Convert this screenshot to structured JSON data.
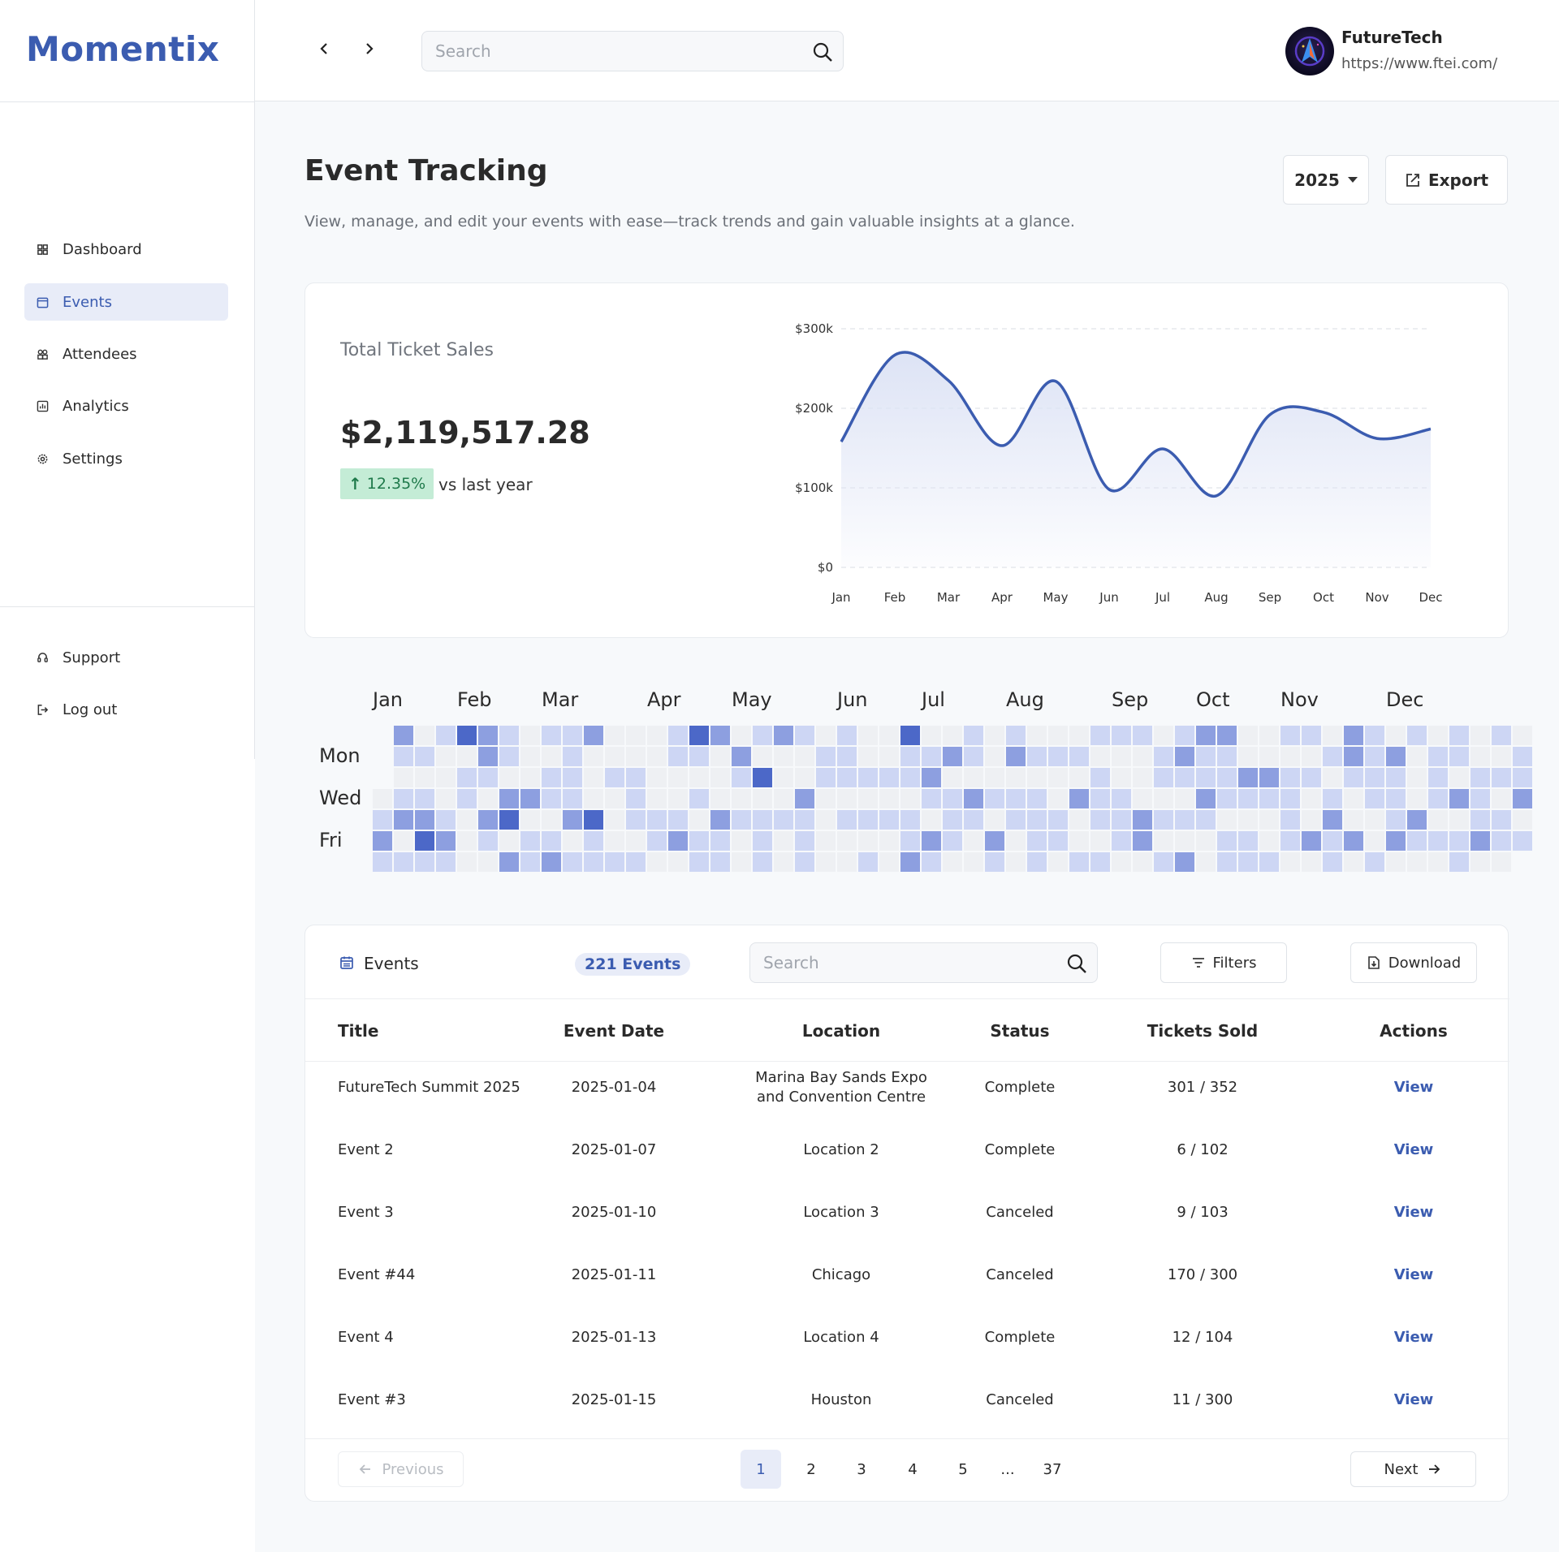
{
  "app": {
    "name": "Momentix"
  },
  "sidebar": {
    "items": [
      {
        "label": "Dashboard",
        "icon": "grid-icon"
      },
      {
        "label": "Events",
        "icon": "calendar-icon",
        "active": true
      },
      {
        "label": "Attendees",
        "icon": "people-icon"
      },
      {
        "label": "Analytics",
        "icon": "chart-icon"
      },
      {
        "label": "Settings",
        "icon": "gear-icon"
      }
    ],
    "bottom_items": [
      {
        "label": "Support",
        "icon": "headset-icon"
      },
      {
        "label": "Log out",
        "icon": "logout-icon"
      }
    ]
  },
  "topbar": {
    "search_placeholder": "Search",
    "company": "FutureTech",
    "url": "https://www.ftei.com/"
  },
  "header": {
    "title": "Event Tracking",
    "subtitle": "View, manage, and edit your events with ease—track trends and gain valuable insights at a glance.",
    "year": "2025",
    "export_label": "Export"
  },
  "sales": {
    "label": "Total Ticket Sales",
    "value": "$2,119,517.28",
    "delta": "12.35%",
    "delta_suffix": "vs last year"
  },
  "chart_data": {
    "type": "area",
    "categories": [
      "Jan",
      "Feb",
      "Mar",
      "Apr",
      "May",
      "Jun",
      "Jul",
      "Aug",
      "Sep",
      "Oct",
      "Nov",
      "Dec"
    ],
    "values": [
      158000,
      267000,
      235000,
      153000,
      234000,
      98000,
      149000,
      90000,
      192000,
      195000,
      162000,
      174000
    ],
    "ylim": [
      0,
      300000
    ],
    "yticks": [
      "$0",
      "$100k",
      "$200k",
      "$300k"
    ],
    "ytick_values": [
      0,
      100000,
      200000,
      300000
    ],
    "grid": true,
    "colors": {
      "line": "#3b5cb0",
      "fill": "#dde3f5"
    }
  },
  "heatmap": {
    "months": [
      "Jan",
      "Feb",
      "Mar",
      "Apr",
      "May",
      "Jun",
      "Jul",
      "Aug",
      "Sep",
      "Oct",
      "Nov",
      "Dec"
    ],
    "day_labels": [
      "Mon",
      "Wed",
      "Fri"
    ],
    "start_weekday": 3,
    "levels": [
      0,
      1,
      2,
      1,
      2,
      1,
      0,
      1,
      2,
      0,
      1,
      0,
      1,
      0,
      1,
      2,
      3,
      1,
      1,
      0,
      0,
      0,
      1,
      2,
      1,
      3,
      0,
      1,
      1,
      0,
      0,
      0,
      2,
      2,
      1,
      0,
      2,
      1,
      0,
      1,
      1,
      0,
      2,
      3,
      0,
      2,
      0,
      0,
      0,
      2,
      0,
      1,
      1,
      1,
      0,
      1,
      1,
      0,
      1,
      2,
      1,
      1,
      1,
      1,
      2,
      0,
      1,
      2,
      0,
      0,
      0,
      3,
      1,
      1,
      0,
      0,
      1,
      0,
      0,
      0,
      1,
      0,
      0,
      1,
      1,
      1,
      0,
      1,
      0,
      0,
      0,
      0,
      1,
      1,
      0,
      1,
      1,
      0,
      0,
      1,
      2,
      0,
      3,
      1,
      0,
      1,
      0,
      1,
      1,
      2,
      0,
      0,
      0,
      2,
      1,
      1,
      0,
      2,
      1,
      0,
      1,
      0,
      0,
      1,
      0,
      3,
      0,
      1,
      1,
      1,
      2,
      0,
      0,
      0,
      1,
      0,
      0,
      1,
      0,
      0,
      2,
      1,
      1,
      1,
      0,
      1,
      1,
      0,
      0,
      0,
      0,
      1,
      1,
      1,
      0,
      1,
      0,
      0,
      0,
      0,
      1,
      0,
      1,
      0,
      1,
      0,
      0,
      1,
      0,
      1,
      0,
      0,
      3,
      1,
      1,
      0,
      1,
      1,
      2,
      0,
      1,
      2,
      1,
      0,
      2,
      1,
      0,
      2,
      0,
      1,
      1,
      1,
      0,
      1,
      1,
      0,
      2,
      1,
      0,
      0,
      0,
      0,
      0,
      1,
      0,
      2,
      1,
      1,
      2,
      0,
      1,
      1,
      0,
      0,
      0,
      1,
      0,
      1,
      1,
      1,
      1,
      0,
      1,
      0,
      0,
      1,
      1,
      0,
      0,
      1,
      0,
      2,
      0,
      0,
      1,
      1,
      0,
      1,
      1,
      1,
      0,
      1,
      1,
      0,
      0,
      1,
      1,
      1,
      0,
      1,
      0,
      0,
      0,
      2,
      2,
      0,
      0,
      1,
      1,
      0,
      1,
      0,
      1,
      1,
      2,
      1,
      0,
      1,
      0,
      2,
      2,
      1,
      1,
      2,
      1,
      0,
      0,
      2,
      1,
      1,
      1,
      0,
      1,
      1,
      0,
      0,
      2,
      1,
      0,
      1,
      1,
      0,
      0,
      2,
      1,
      0,
      0,
      1,
      1,
      0,
      1,
      1,
      1,
      1,
      0,
      1,
      0,
      1,
      0,
      0,
      2,
      0,
      0,
      1,
      0,
      1,
      2,
      1,
      1,
      2,
      2,
      1,
      0,
      0,
      2,
      0,
      1,
      1,
      1,
      1,
      0,
      0,
      1,
      0,
      2,
      1,
      1,
      1,
      2,
      0,
      1,
      0,
      0,
      0,
      2,
      1,
      0,
      0,
      1,
      1,
      1,
      0,
      1,
      0,
      1,
      1,
      0,
      2,
      0,
      1,
      1,
      0,
      0,
      1,
      1,
      1,
      2,
      0,
      1,
      0,
      1,
      0,
      1,
      1,
      0,
      0,
      1,
      1,
      2,
      0,
      1
    ]
  },
  "events": {
    "label": "Events",
    "count": "221 Events",
    "search_placeholder": "Search",
    "filters_label": "Filters",
    "download_label": "Download",
    "columns": [
      "Title",
      "Event Date",
      "Location",
      "Status",
      "Tickets Sold",
      "Actions"
    ],
    "rows": [
      {
        "title": "FutureTech Summit 2025",
        "date": "2025-01-04",
        "location": "Marina Bay Sands Expo and Convention Centre",
        "status": "Complete",
        "tickets": "301 / 352",
        "action": "View"
      },
      {
        "title": "Event 2",
        "date": "2025-01-07",
        "location": "Location 2",
        "status": "Complete",
        "tickets": "6 / 102",
        "action": "View"
      },
      {
        "title": "Event 3",
        "date": "2025-01-10",
        "location": "Location 3",
        "status": "Canceled",
        "tickets": "9 / 103",
        "action": "View"
      },
      {
        "title": "Event #44",
        "date": "2025-01-11",
        "location": "Chicago",
        "status": "Canceled",
        "tickets": "170 / 300",
        "action": "View"
      },
      {
        "title": "Event 4",
        "date": "2025-01-13",
        "location": "Location 4",
        "status": "Complete",
        "tickets": "12 / 104",
        "action": "View"
      },
      {
        "title": "Event #3",
        "date": "2025-01-15",
        "location": "Houston",
        "status": "Canceled",
        "tickets": "11 / 300",
        "action": "View"
      }
    ],
    "pagination": {
      "prev_label": "Previous",
      "next_label": "Next",
      "pages": [
        "1",
        "2",
        "3",
        "4",
        "5",
        "...",
        "37"
      ],
      "current": "1"
    }
  },
  "colors": {
    "accent": "#3b5cb0",
    "heat_levels": [
      "#eef0f3",
      "#cdd6f4",
      "#8d9fe0",
      "#4c68c8"
    ],
    "delta_bg": "#c4ecd6",
    "delta_text": "#1f7a4b"
  }
}
